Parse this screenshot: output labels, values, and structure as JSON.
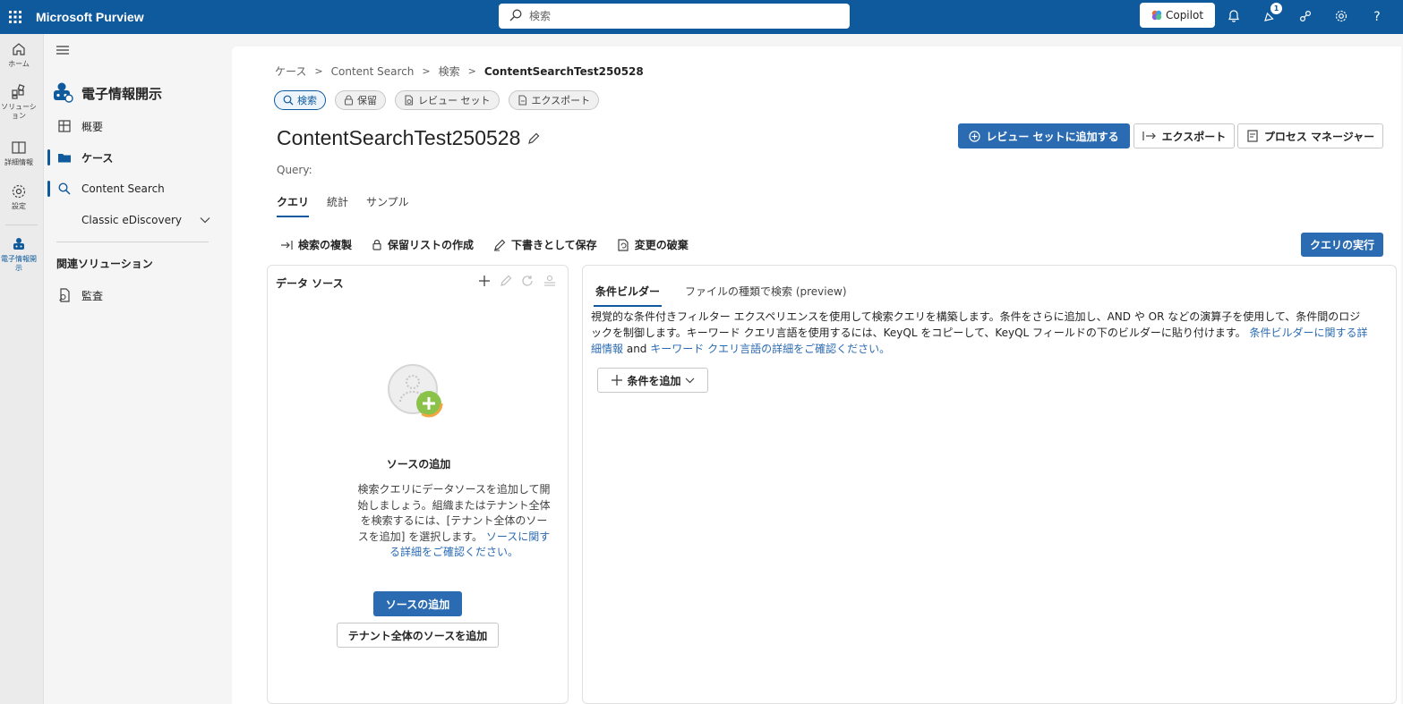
{
  "header": {
    "app_title": "Microsoft Purview",
    "search_placeholder": "検索",
    "copilot_label": "Copilot",
    "notification_count": "1",
    "colors": {
      "bar": "#0f5a9c",
      "accent": "#2b6bb2"
    }
  },
  "rail": {
    "items": [
      {
        "label": "ホーム",
        "icon": "home-icon"
      },
      {
        "label": "ソリューション",
        "icon": "solutions-icon"
      },
      {
        "label": "詳細情報",
        "icon": "learn-icon"
      },
      {
        "label": "設定",
        "icon": "settings-icon"
      },
      {
        "label": "電子情報開示",
        "icon": "ediscovery-icon"
      }
    ]
  },
  "nav": {
    "header": "電子情報開示",
    "items": [
      {
        "label": "概要",
        "icon": "overview-icon"
      },
      {
        "label": "ケース",
        "icon": "folder-icon"
      },
      {
        "label": "Content Search",
        "icon": "search-icon"
      },
      {
        "label": "Classic eDiscovery",
        "icon": "chevron-down-icon"
      }
    ],
    "section_title": "関連ソリューション",
    "section_items": [
      {
        "label": "監査",
        "icon": "audit-icon"
      }
    ]
  },
  "breadcrumb": [
    "ケース",
    "Content Search",
    "検索",
    "ContentSearchTest250528"
  ],
  "pills": [
    {
      "label": "検索",
      "icon": "search-icon"
    },
    {
      "label": "保留",
      "icon": "lock-icon"
    },
    {
      "label": "レビュー セット",
      "icon": "review-set-icon"
    },
    {
      "label": "エクスポート",
      "icon": "export-icon"
    }
  ],
  "page": {
    "title": "ContentSearchTest250528",
    "query_label": "Query:",
    "actions": {
      "add_to_review": "レビュー セットに追加する",
      "export": "エクスポート",
      "process_manager": "プロセス マネージャー"
    },
    "tabs": [
      "クエリ",
      "統計",
      "サンプル"
    ]
  },
  "toolbar": {
    "duplicate": "検索の複製",
    "hold_list": "保留リストの作成",
    "save_draft": "下書きとして保存",
    "discard": "変更の破棄",
    "run_query": "クエリの実行"
  },
  "data_source": {
    "title": "データ ソース",
    "heading": "ソースの追加",
    "description": "検索クエリにデータソースを追加して開始しましょう。組織またはテナント全体を検索するには、[テナント全体のソースを追加] を選択します。",
    "link": "ソースに関する詳細をご確認ください。",
    "add_button": "ソースの追加",
    "tenant_button": "テナント全体のソースを追加"
  },
  "query_builder": {
    "tabs": [
      "条件ビルダー",
      "ファイルの種類で検索 (preview)"
    ],
    "description": "視覚的な条件付きフィルター エクスペリエンスを使用して検索クエリを構築します。条件をさらに追加し、AND や OR などの演算子を使用して、条件間のロジックを制御します。キーワード クエリ言語を使用するには、KeyQL をコピーして、KeyQL フィールドの下のビルダーに貼り付けます。",
    "link1": "条件ビルダーに関する詳細情報",
    "conj": "and",
    "link2": "キーワード クエリ言語の詳細をご確認ください。",
    "add_condition": "条件を追加"
  }
}
